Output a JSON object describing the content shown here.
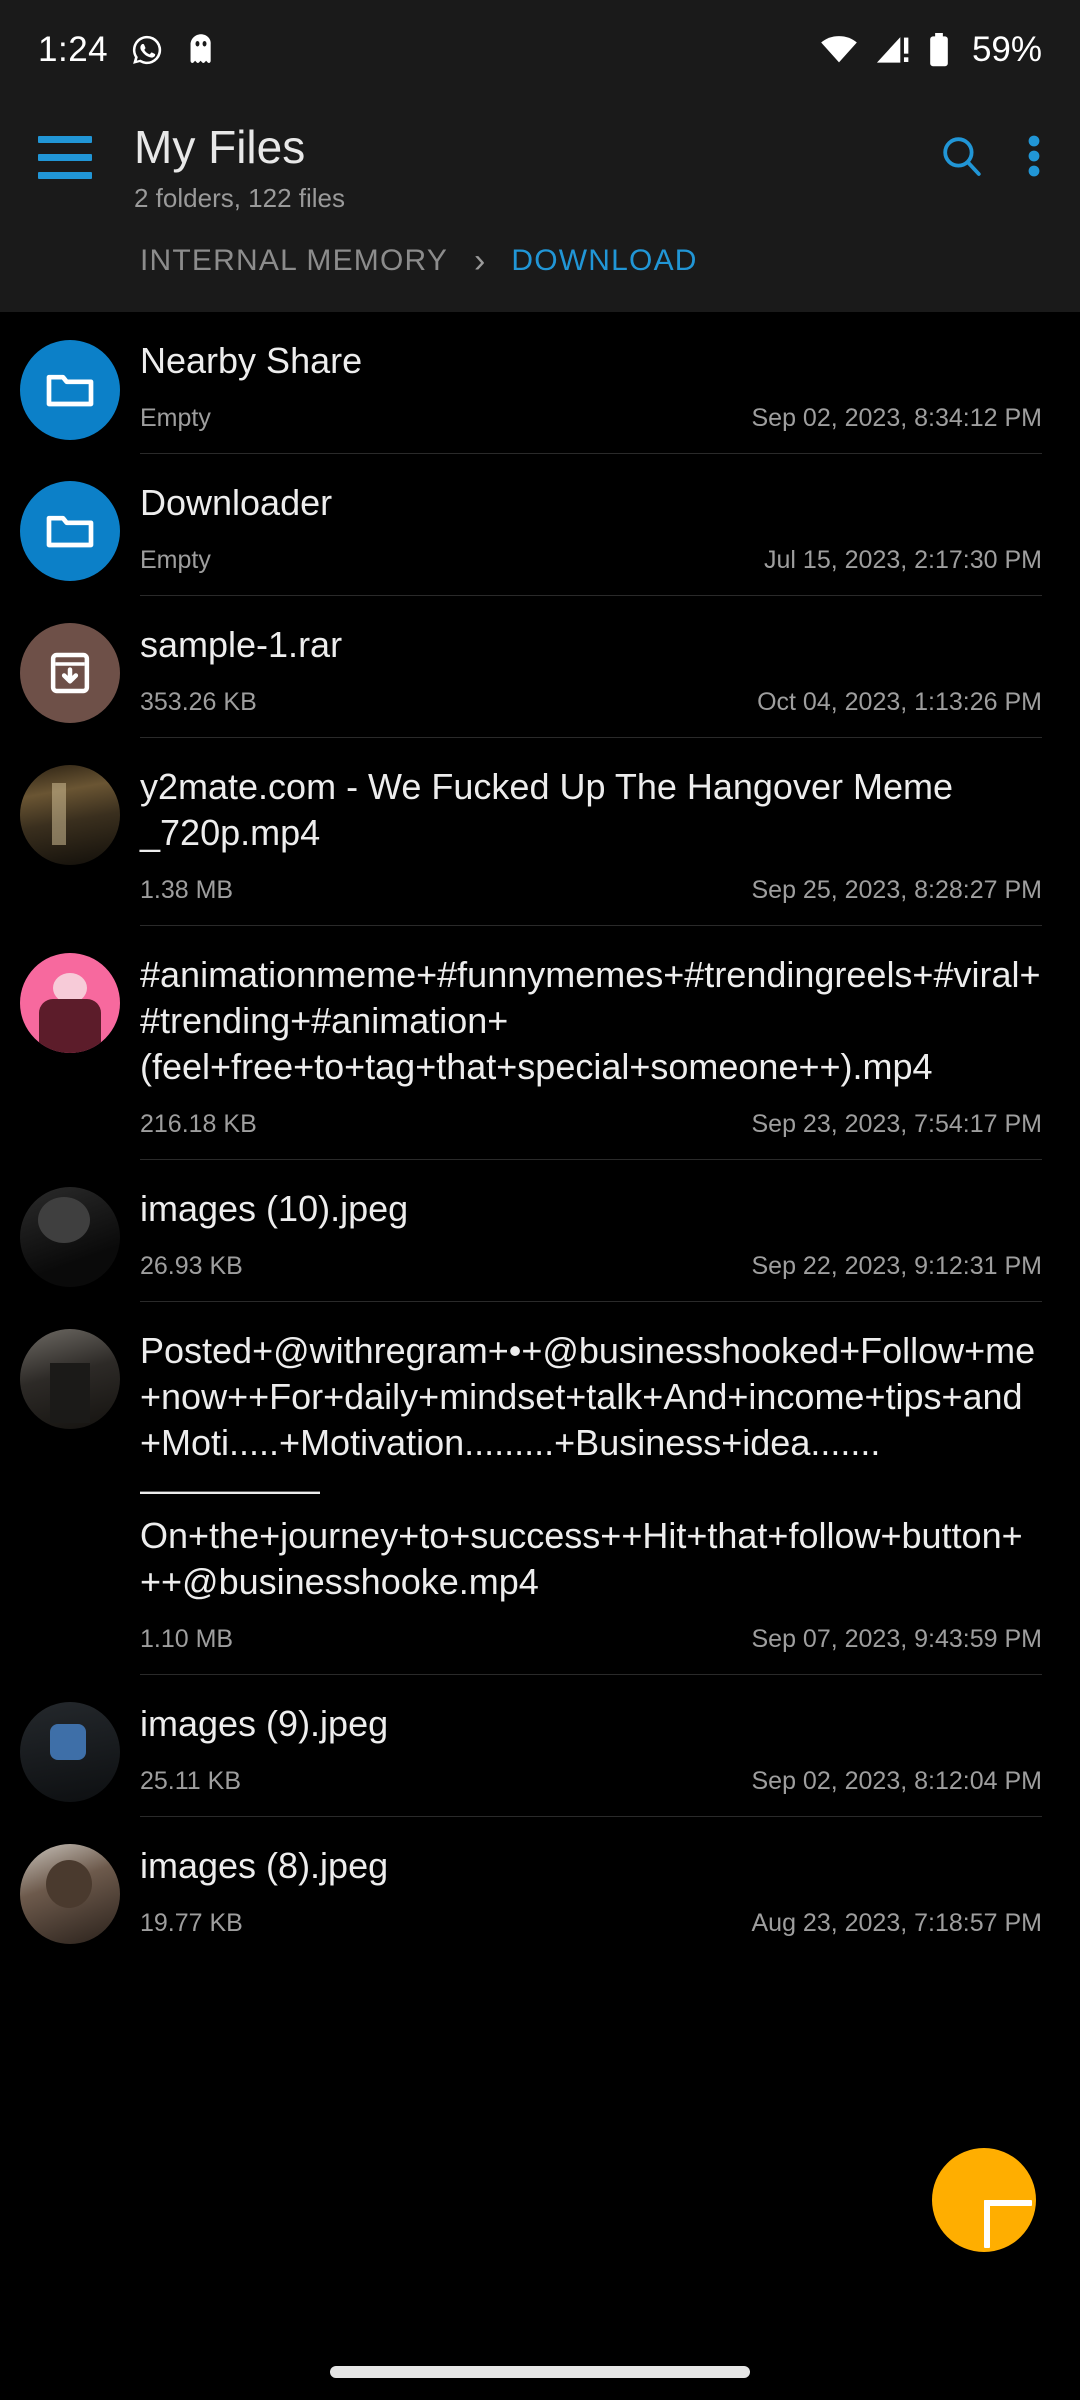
{
  "status_bar": {
    "time": "1:24",
    "left_icons": [
      "whatsapp-icon",
      "ghost-icon"
    ],
    "right_icons": [
      "wifi-icon",
      "cellular-signal-alert-icon",
      "battery-icon"
    ],
    "battery_percent": "59%"
  },
  "app_bar": {
    "menu_icon": "hamburger-menu-icon",
    "title": "My Files",
    "subtitle": "2 folders, 122 files",
    "search_icon": "search-icon",
    "overflow_icon": "more-vertical-icon",
    "accent_color": "#2196D6"
  },
  "breadcrumb": {
    "separator": "›",
    "items": [
      {
        "label": "INTERNAL MEMORY",
        "active": false
      },
      {
        "label": "DOWNLOAD",
        "active": true
      }
    ]
  },
  "files": [
    {
      "name": "Nearby Share",
      "size": "Empty",
      "date": "Sep 02, 2023, 8:34:12 PM",
      "icon": "folder-icon",
      "icon_color": "#0C80C8"
    },
    {
      "name": "Downloader",
      "size": "Empty",
      "date": "Jul 15, 2023, 2:17:30 PM",
      "icon": "folder-icon",
      "icon_color": "#0C80C8"
    },
    {
      "name": "sample-1.rar",
      "size": "353.26 KB",
      "date": "Oct 04, 2023, 1:13:26 PM",
      "icon": "archive-icon",
      "icon_color": "#6E5048"
    },
    {
      "name": "y2mate.com - We Fucked Up The Hangover Meme _720p.mp4",
      "size": "1.38 MB",
      "date": "Sep 25, 2023, 8:28:27 PM",
      "icon": "video-thumbnail",
      "icon_color": "#6a5533"
    },
    {
      "name": "#animationmeme+#funnymemes+#trendingreels+#viral+#trending+#animation+(feel+free+to+tag+that+special+someone++).mp4",
      "size": "216.18 KB",
      "date": "Sep 23, 2023, 7:54:17 PM",
      "icon": "video-thumbnail",
      "icon_color": "#F7699E"
    },
    {
      "name": "images (10).jpeg",
      "size": "26.93 KB",
      "date": "Sep 22, 2023, 9:12:31 PM",
      "icon": "image-thumbnail",
      "icon_color": "#2b2b2b"
    },
    {
      "name": "Posted+@withregram+•+@businesshooked+Follow+me+now++For+daily+mindset+talk+And+income+tips+and+Moti.....+Motivation.........+Business+idea.......—————On+the+journey+to+success++Hit+that+follow+button+++@businesshooke.mp4",
      "size": "1.10 MB",
      "date": "Sep 07, 2023, 9:43:59 PM",
      "icon": "video-thumbnail",
      "icon_color": "#6e6a64"
    },
    {
      "name": "images (9).jpeg",
      "size": "25.11 KB",
      "date": "Sep 02, 2023, 8:12:04 PM",
      "icon": "image-thumbnail",
      "icon_color": "#3E6FA8"
    },
    {
      "name": "images (8).jpeg",
      "size": "19.77 KB",
      "date": "Aug 23, 2023, 7:18:57 PM",
      "icon": "image-thumbnail",
      "icon_color": "#6d5a4c"
    }
  ],
  "fab": {
    "icon": "plus-icon",
    "color": "#FFAE00"
  },
  "navigation_bar": {
    "handle": "home-gesture-pill"
  }
}
